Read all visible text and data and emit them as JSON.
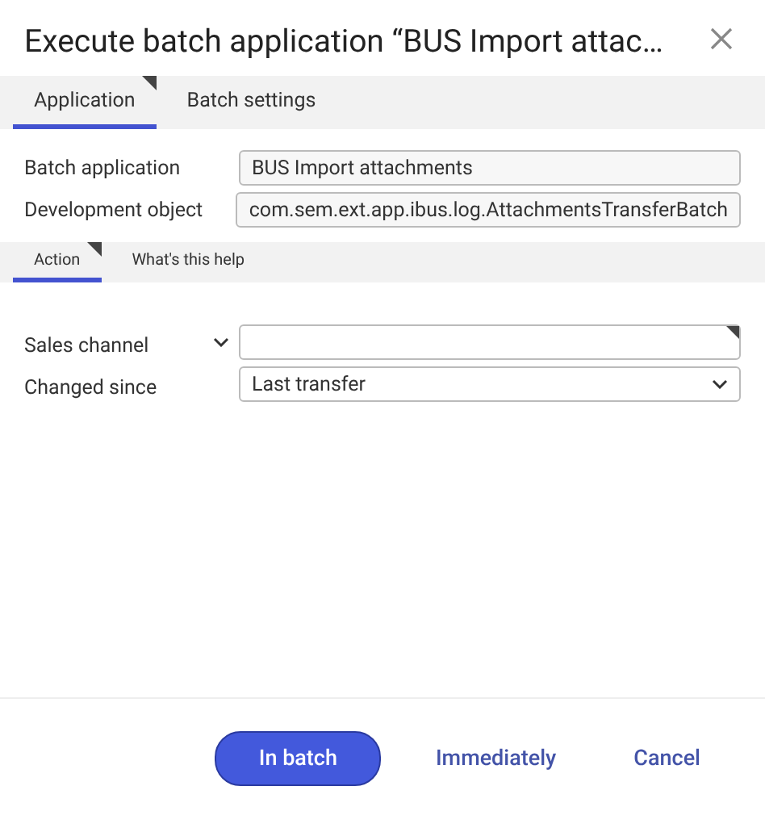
{
  "window": {
    "title": "Execute batch application “BUS Import attac…"
  },
  "tabs": [
    {
      "label": "Application",
      "selected": true
    },
    {
      "label": "Batch settings",
      "selected": false
    }
  ],
  "fields": [
    {
      "label": "Batch application",
      "value": "BUS Import attachments"
    },
    {
      "label": "Development object",
      "value": "com.sem.ext.app.ibus.log.AttachmentsTransferBatch"
    }
  ],
  "subtabs": [
    {
      "label": "Action",
      "selected": true
    },
    {
      "label": "What's this help",
      "selected": false
    }
  ],
  "options": [
    {
      "kind": "lookup",
      "label": "Sales channel"
    },
    {
      "kind": "select",
      "label": "Changed since",
      "value": "Last transfer"
    }
  ],
  "buttons": [
    {
      "label": "In batch",
      "kind": "primary"
    },
    {
      "label": "Immediately",
      "kind": "text"
    },
    {
      "label": "Cancel",
      "kind": "text"
    }
  ]
}
